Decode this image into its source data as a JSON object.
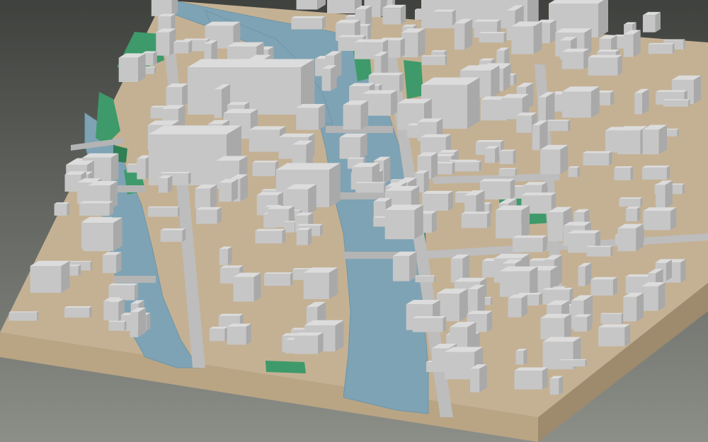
{
  "scene": {
    "colors": {
      "background_top": "#3f413e",
      "background_bottom": "#8c8f88",
      "terrain": "#c4b194",
      "terrain_side_dark": "#9e8a6c",
      "terrain_side_light": "#b9a584",
      "water": "#7ea3b4",
      "water_edge": "#6f95a8",
      "vegetation": "#3e9a6a",
      "vegetation_dark": "#2f7f55",
      "building_top": "#dcdcdc",
      "building_front": "#c6c6c6",
      "building_side": "#a9a9a9",
      "road": "#bdbdbd",
      "bridge": "#b4b4b4"
    },
    "icons": []
  }
}
